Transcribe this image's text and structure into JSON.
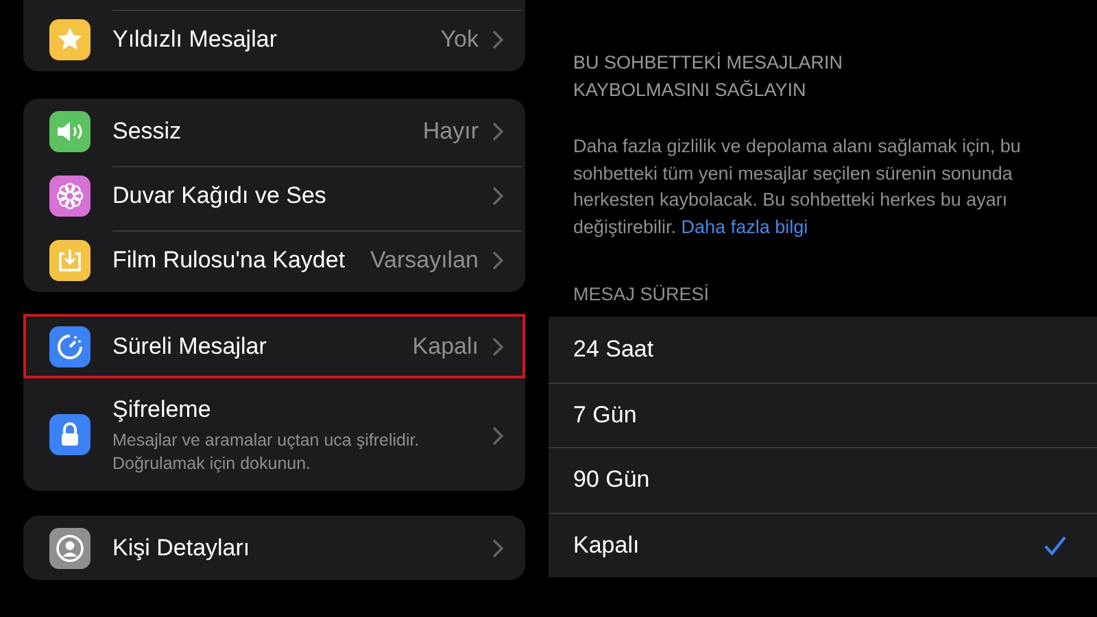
{
  "settings_groups": [
    {
      "items": [
        {
          "kind": "star",
          "label": "Yıldızlı Mesajlar",
          "value": "Yok",
          "highlighted": false
        }
      ]
    },
    {
      "items": [
        {
          "kind": "speaker",
          "label": "Sessiz",
          "value": "Hayır",
          "highlighted": false
        },
        {
          "kind": "flower",
          "label": "Duvar Kağıdı ve Ses",
          "highlighted": false
        },
        {
          "kind": "save",
          "label": "Film Rulosu'na Kaydet",
          "value": "Varsayılan",
          "highlighted": false
        }
      ]
    },
    {
      "items": [
        {
          "kind": "timer",
          "label": "Süreli Mesajlar",
          "value": "Kapalı",
          "highlighted": true
        },
        {
          "kind": "lock",
          "label": "Şifreleme",
          "subtitle": "Mesajlar ve aramalar uçtan uca şifrelidir. Doğrulamak için dokunun.",
          "highlighted": false
        }
      ]
    },
    {
      "items": [
        {
          "kind": "person",
          "label": "Kişi Detayları",
          "highlighted": false
        }
      ]
    }
  ],
  "disappearing": {
    "heading": "BU SOHBETTEKİ MESAJLARIN KAYBOLMASINI SAĞLAYIN",
    "description": "Daha fazla gizlilik ve depolama alanı sağlamak için, bu sohbetteki tüm yeni mesajlar seçilen sürenin sonunda herkesten kaybolacak. Bu sohbetteki herkes bu ayarı değiştirebilir.",
    "link": "Daha fazla bilgi",
    "duration_label": "MESAJ SÜRESİ",
    "options": [
      {
        "label": "24 Saat",
        "selected": false
      },
      {
        "label": "7 Gün",
        "selected": false
      },
      {
        "label": "90 Gün",
        "selected": false
      },
      {
        "label": "Kapalı",
        "selected": true
      }
    ]
  }
}
